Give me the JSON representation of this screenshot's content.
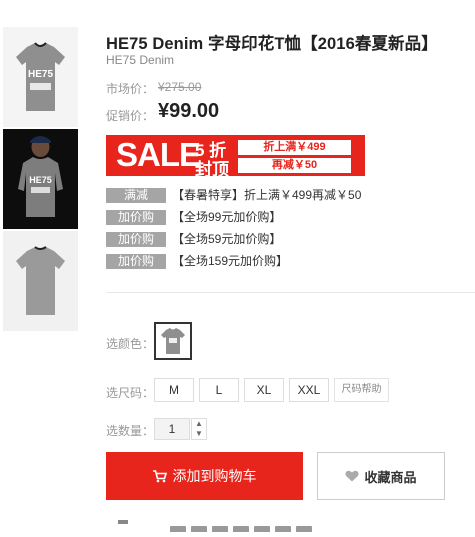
{
  "product": {
    "title": "HE75 Denim 字母印花T恤【2016春夏新品】",
    "brand": "HE75 Denim",
    "market_price_label": "市场价：",
    "market_price": "¥275.00",
    "sale_price_label": "促销价：",
    "sale_price": "¥99.00"
  },
  "thumbnails": [
    {
      "print": "HE75"
    },
    {
      "print": "HE75"
    },
    {
      "print": ""
    }
  ],
  "banner": {
    "big": "SALE",
    "char1": "5 折",
    "char2": "封顶",
    "line1": "折上满￥499",
    "line2": "再减￥50"
  },
  "promotions": [
    {
      "tag": "满减",
      "text": "【春暑特享】折上满￥499再减￥50"
    },
    {
      "tag": "加价购",
      "text": "【全场99元加价购】"
    },
    {
      "tag": "加价购",
      "text": "【全场59元加价购】"
    },
    {
      "tag": "加价购",
      "text": "【全场159元加价购】"
    }
  ],
  "options": {
    "color_label": "选颜色：",
    "size_label": "选尺码：",
    "sizes": [
      "M",
      "L",
      "XL",
      "XXL"
    ],
    "size_help": "尺码帮助",
    "qty_label": "选数量：",
    "qty_value": "1"
  },
  "actions": {
    "add_to_cart": "添加到购物车",
    "favorite": "收藏商品"
  },
  "colors": {
    "accent": "#e8251d",
    "tag_gray": "#a5a5a5"
  }
}
